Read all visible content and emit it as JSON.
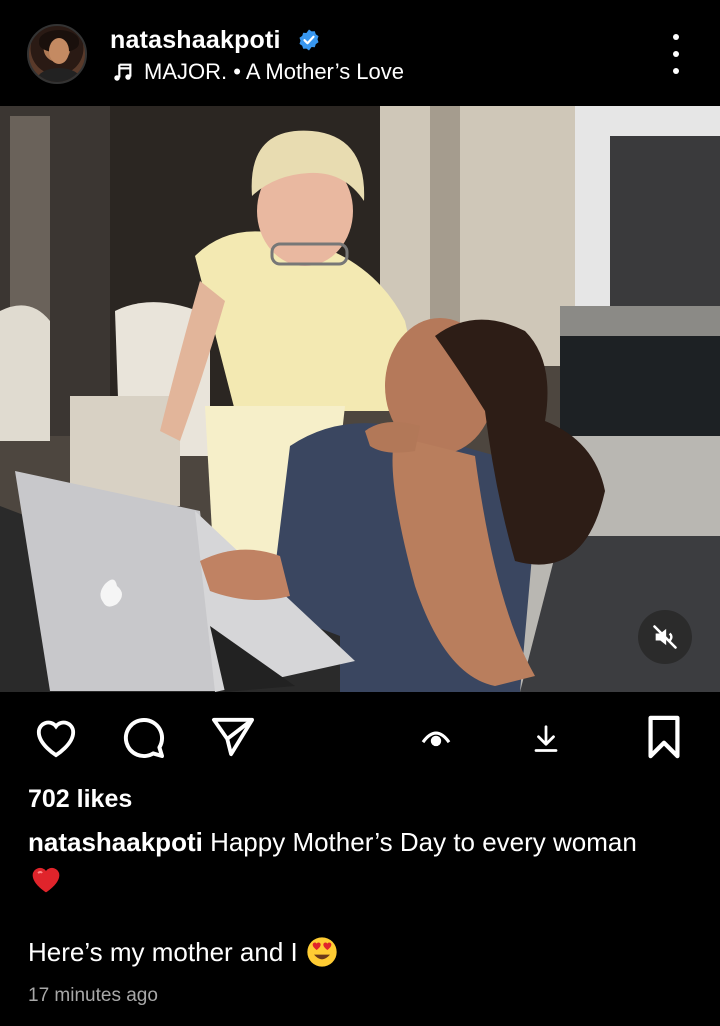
{
  "post": {
    "username": "natashaakpoti",
    "verified": true,
    "music": {
      "title": "MAJOR.",
      "separator": " • ",
      "track": "A Mother’s Love"
    },
    "likes": "702 likes",
    "caption_user": "natashaakpoti",
    "caption_text": "Happy Mother’s Day to every woman",
    "caption_line2": "Here’s my mother and I",
    "time": "17 minutes ago"
  },
  "icons": {
    "more": "more-vertical-icon",
    "music": "music-note-icon",
    "verified": "verified-badge-icon",
    "mute": "volume-muted-icon",
    "like": "heart-outline-icon",
    "comment": "comment-bubble-icon",
    "share": "paper-plane-icon",
    "view": "eye-icon",
    "download": "download-icon",
    "save": "bookmark-icon",
    "emoji_heart": "red-heart-emoji",
    "emoji_eyes": "heart-eyes-emoji"
  },
  "colors": {
    "background": "#000000",
    "text": "#ffffff",
    "muted_text": "#a8a8a8",
    "verified": "#3897f0",
    "heart": "#e0242b"
  }
}
